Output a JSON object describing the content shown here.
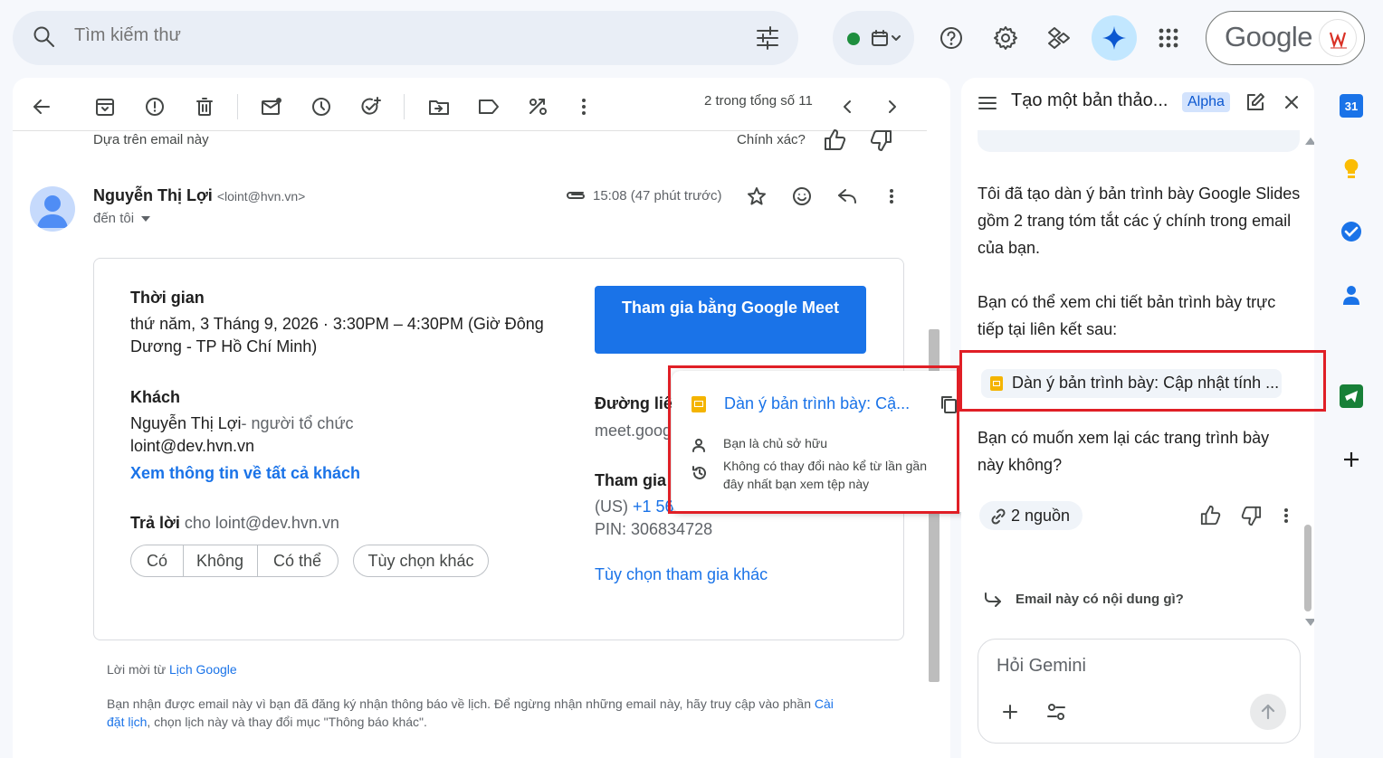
{
  "topbar": {
    "search_placeholder": "Tìm kiếm thư",
    "google_word": "Google",
    "status_color": "#1e8e3e"
  },
  "toolbar": {
    "pager": "2 trong tổng số 11"
  },
  "ai_feedback": {
    "based_on": "Dựa trên email này",
    "accurate": "Chính xác?"
  },
  "message": {
    "sender_name": "Nguyễn Thị Lợi",
    "sender_email": "<loint@hvn.vn>",
    "to": "đến tôi",
    "time": "15:08 (47 phút trước)"
  },
  "invite": {
    "time_heading": "Thời gian",
    "time_line1": "thứ năm, 3 Tháng 9, 2026 · 3:30PM – 4:30PM (Giờ Đông",
    "time_line2": "Dương - TP Hồ Chí Minh)",
    "guests_heading": "Khách",
    "guest_name": "Nguyễn Thị Lợi",
    "guest_role": "- người tổ chức",
    "guest_email": "loint@dev.hvn.vn",
    "view_all_guests": "Xem thông tin về tất cả khách",
    "reply_heading": "Trả lời",
    "reply_to": "cho loint@dev.hvn.vn",
    "rsvp": [
      "Có",
      "Không",
      "Có thể"
    ],
    "more_options": "Tùy chọn khác",
    "meet_button": "Tham gia bằng Google Meet",
    "link_heading": "Đường liên",
    "meet_link": "meet.goog",
    "join_heading": "Tham gia b",
    "phone_prefix": "(US) ",
    "phone": "+1 56",
    "pin": "PIN: 306834728",
    "other_join": "Tùy chọn tham gia khác"
  },
  "footer": {
    "invite_from": "Lời mời từ ",
    "calendar_link": "Lịch Google",
    "notice": "Bạn nhận được email này vì bạn đã đăng ký nhận thông báo về lịch. Để ngừng nhận những email này, hãy truy cập vào phần ",
    "settings_link1": "Cài",
    "settings_link2": "đặt lịch",
    "notice_tail": ", chọn lịch này và thay đổi mục \"Thông báo khác\"."
  },
  "popup": {
    "title": "Dàn ý bản trình bày: Cậ...",
    "owner": "Bạn là chủ sở hữu",
    "changes_line1": "Không có thay đổi nào kể từ lần gần",
    "changes_line2": "đây nhất bạn xem tệp này"
  },
  "gemini": {
    "title": "Tạo một bản thảo...",
    "badge": "Alpha",
    "msg1_l1": "Tôi đã tạo dàn ý bản trình bày Google Slides",
    "msg1_l2": "gồm 2 trang tóm tắt các ý chính trong email",
    "msg1_l3": "của bạn.",
    "msg2_l1": "Bạn có thể xem chi tiết bản trình bày trực",
    "msg2_l2": "tiếp tại liên kết sau:",
    "chip": "Dàn ý bản trình bày: Cập nhật tính ...",
    "msg3_l1": "Bạn có muốn xem lại các trang trình bày",
    "msg3_l2": "này không?",
    "sources": "2 nguồn",
    "suggestion": "Email này có nội dung gì?",
    "ask_placeholder": "Hỏi Gemini"
  },
  "rail": {
    "calendar_day": "31"
  }
}
